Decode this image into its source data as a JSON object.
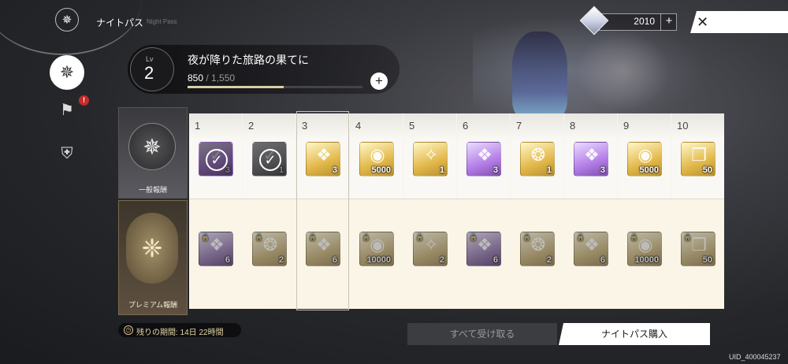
{
  "header": {
    "title": "ナイトパス",
    "subtitle": "Night Pass",
    "currency_value": "2010",
    "currency_plus": "+",
    "close_glyph": "✕"
  },
  "nav": {
    "badge_count": "!",
    "items": [
      {
        "icon": "compass-icon",
        "glyph": "✵"
      },
      {
        "icon": "mission-icon",
        "glyph": "⚑"
      },
      {
        "icon": "shop-icon",
        "glyph": "⛨"
      }
    ]
  },
  "level": {
    "lv_label": "Lv",
    "lv_value": "2",
    "title": "夜が降りた旅路の果てに",
    "xp_current": "850",
    "xp_separator": " / ",
    "xp_max": "1,550",
    "xp_fraction": 0.548,
    "plus": "+"
  },
  "tracks": {
    "normal_label": "一般報酬",
    "premium_label": "プレミアム報酬"
  },
  "columns": [
    {
      "num": "1",
      "top": {
        "type": "purple",
        "glyph": "✓",
        "qty": "3",
        "claimed": true
      },
      "bottom": {
        "type": "purple",
        "glyph": "❖",
        "qty": "6"
      }
    },
    {
      "num": "2",
      "top": {
        "type": "gray",
        "glyph": "✓",
        "qty": "1",
        "claimed": true
      },
      "bottom": {
        "type": "gold",
        "glyph": "❂",
        "qty": "2"
      }
    },
    {
      "num": "3",
      "top": {
        "type": "gold",
        "glyph": "❖",
        "qty": "3",
        "claimed": false
      },
      "bottom": {
        "type": "gold",
        "glyph": "❖",
        "qty": "6"
      }
    },
    {
      "num": "4",
      "top": {
        "type": "gold",
        "glyph": "◉",
        "qty": "5000",
        "claimed": false
      },
      "bottom": {
        "type": "gold",
        "glyph": "◉",
        "qty": "10000"
      }
    },
    {
      "num": "5",
      "top": {
        "type": "gold",
        "glyph": "✧",
        "qty": "1",
        "claimed": false
      },
      "bottom": {
        "type": "gold",
        "glyph": "✧",
        "qty": "2"
      }
    },
    {
      "num": "6",
      "top": {
        "type": "purple",
        "glyph": "❖",
        "qty": "3",
        "claimed": false
      },
      "bottom": {
        "type": "purple",
        "glyph": "❖",
        "qty": "6"
      }
    },
    {
      "num": "7",
      "top": {
        "type": "gold",
        "glyph": "❂",
        "qty": "1",
        "claimed": false
      },
      "bottom": {
        "type": "gold",
        "glyph": "❂",
        "qty": "2"
      }
    },
    {
      "num": "8",
      "top": {
        "type": "purple",
        "glyph": "❖",
        "qty": "3",
        "claimed": false
      },
      "bottom": {
        "type": "gold",
        "glyph": "❖",
        "qty": "6"
      }
    },
    {
      "num": "9",
      "top": {
        "type": "gold",
        "glyph": "◉",
        "qty": "5000",
        "claimed": false
      },
      "bottom": {
        "type": "gold",
        "glyph": "◉",
        "qty": "10000"
      }
    },
    {
      "num": "10",
      "top": {
        "type": "gold",
        "glyph": "❒",
        "qty": "50",
        "claimed": false
      },
      "bottom": {
        "type": "gold",
        "glyph": "❒",
        "qty": "50"
      }
    }
  ],
  "footer": {
    "remaining_label": "残りの期間: 14日 22時間",
    "claim_all": "すべて受け取る",
    "buy_pass": "ナイトパス購入",
    "uid": "UID_400045237"
  },
  "colors": {
    "accent_gold": "#d9cfa6",
    "badge_red": "#c42c2c"
  }
}
